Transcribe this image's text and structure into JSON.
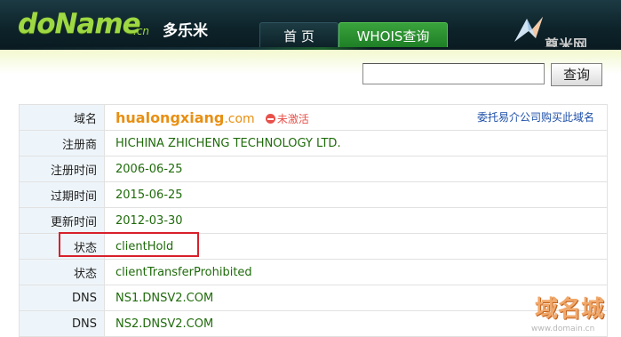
{
  "header": {
    "logo_text": "doName",
    "logo_suffix": ".cn",
    "brand_cn": "多乐米",
    "nav": [
      {
        "label": "首 页"
      },
      {
        "label": "WHOIS查询"
      }
    ],
    "watermark": "尊米网"
  },
  "search": {
    "value": "",
    "button_label": "查询"
  },
  "domain": {
    "name": "hualongxiang",
    "tld": ".com",
    "status_badge": "未激活",
    "broker_link": "委托易介公司购买此域名"
  },
  "rows": [
    {
      "label": "注册商",
      "value": "HICHINA ZHICHENG TECHNOLOGY LTD."
    },
    {
      "label": "注册时间",
      "value": "2006-06-25"
    },
    {
      "label": "过期时间",
      "value": "2015-06-25"
    },
    {
      "label": "更新时间",
      "value": "2012-03-30"
    },
    {
      "label": "状态",
      "value": "clientHold"
    },
    {
      "label": "状态",
      "value": "clientTransferProhibited"
    },
    {
      "label": "DNS",
      "value": "NS1.DNSV2.COM"
    },
    {
      "label": "DNS",
      "value": "NS2.DNSV2.COM"
    }
  ],
  "domain_label": "域名",
  "watermark_bottom": {
    "text": "域名城",
    "url": "www.domain.cn"
  },
  "colors": {
    "brand_green": "#9ed842",
    "domain_orange": "#e88f12",
    "value_green": "#1f6b0b",
    "highlight_red": "#d8202b"
  }
}
